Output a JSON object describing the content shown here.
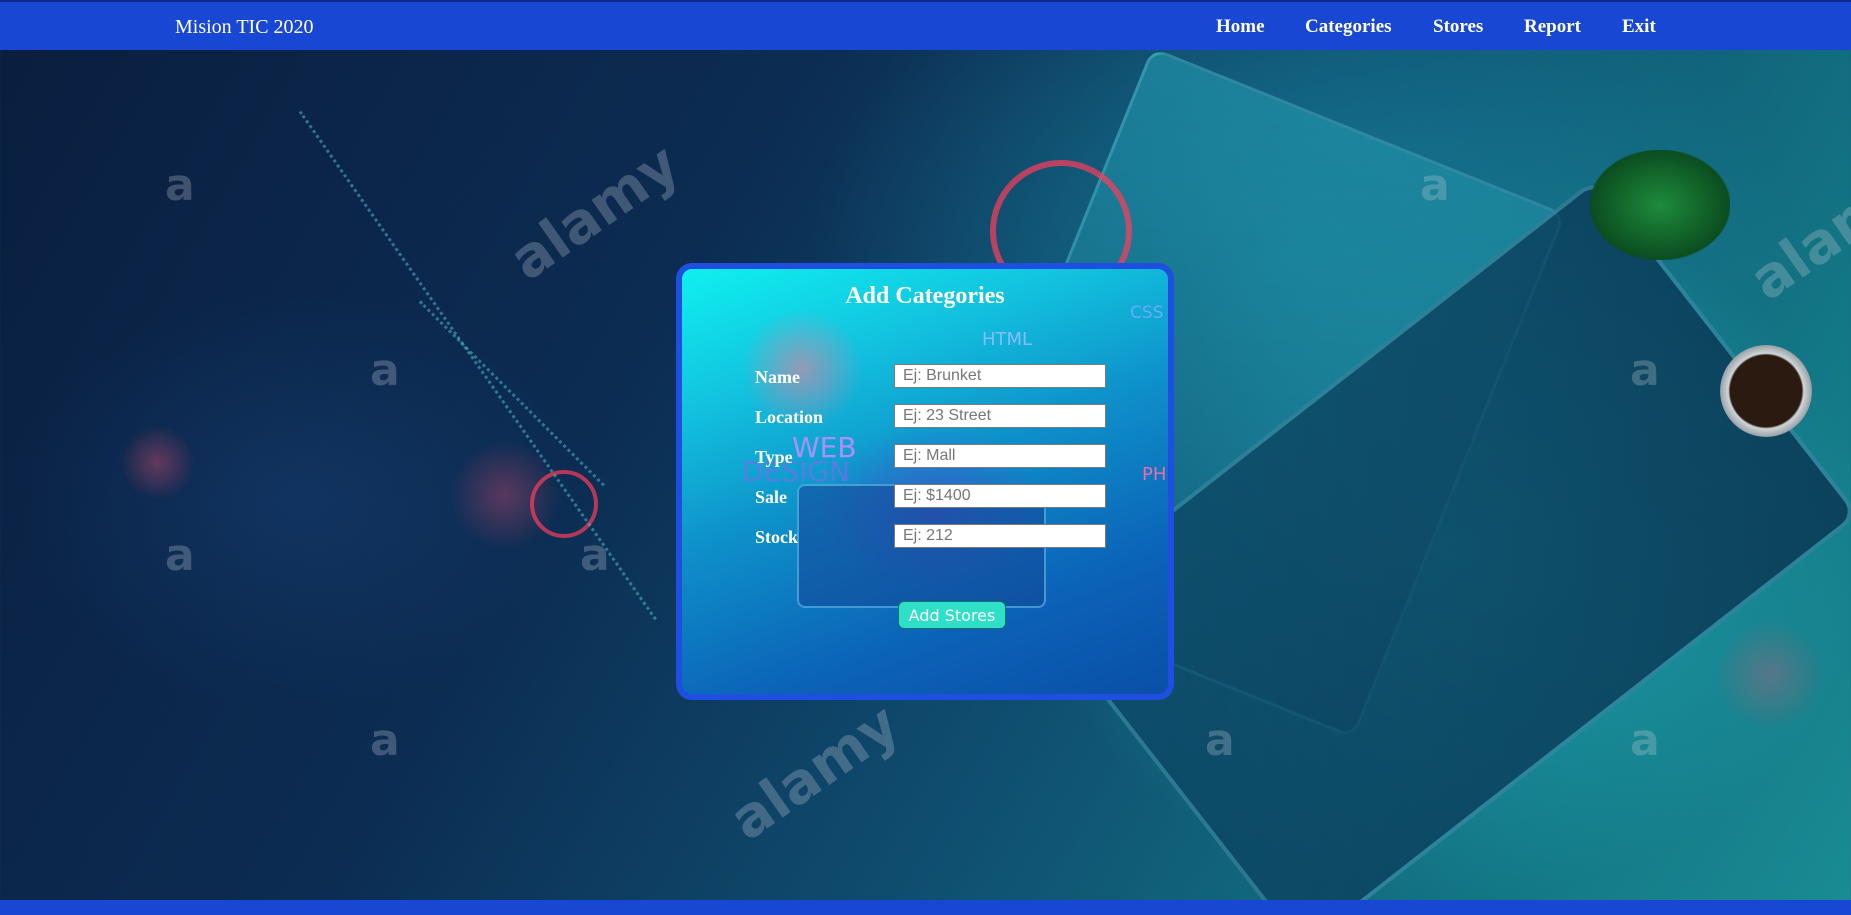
{
  "header": {
    "brand": "Mision TIC 2020",
    "nav": [
      {
        "label": "Home"
      },
      {
        "label": "Categories"
      },
      {
        "label": "Stores"
      },
      {
        "label": "Report"
      },
      {
        "label": "Exit"
      }
    ]
  },
  "form": {
    "title": "Add Categories",
    "fields": [
      {
        "label": "Name",
        "placeholder": "Ej: Brunket",
        "value": ""
      },
      {
        "label": "Location",
        "placeholder": "Ej: 23 Street",
        "value": ""
      },
      {
        "label": "Type",
        "placeholder": "Ej: Mall",
        "value": ""
      },
      {
        "label": "Sale",
        "placeholder": "Ej: $1400",
        "value": ""
      },
      {
        "label": "Stock",
        "placeholder": "Ej: 212",
        "value": ""
      }
    ],
    "submit_label": "Add Stores"
  },
  "background": {
    "watermark": "alamy",
    "decor_texts": [
      "HTML",
      "CSS",
      "WEB",
      "DESIGN",
      "PH"
    ]
  },
  "colors": {
    "nav_bg": "#1847d3",
    "modal_border": "#1f4fe0",
    "button_bg": "#2fe0c8"
  }
}
